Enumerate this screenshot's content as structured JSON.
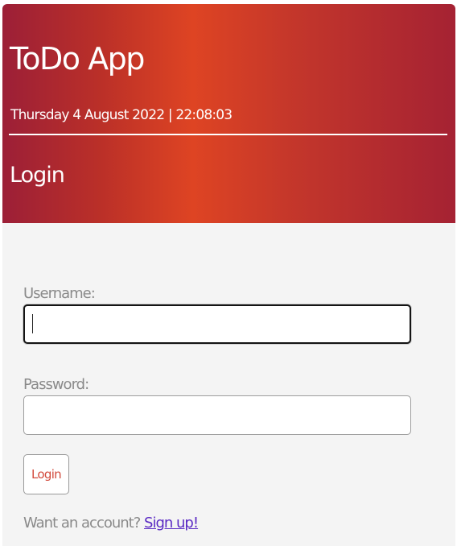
{
  "header": {
    "app_title": "ToDo App",
    "datetime": "Thursday 4 August 2022 | 22:08:03",
    "section_title": "Login"
  },
  "form": {
    "username_label": "Username:",
    "username_value": "",
    "password_label": "Password:",
    "password_value": "",
    "login_button_label": "Login",
    "signup_prompt": "Want an account?",
    "signup_link_label": "Sign up!"
  },
  "colors": {
    "header_gradient": [
      "#9c1f37",
      "#de4423",
      "#a52233"
    ],
    "button_text": "#d24a3c",
    "link": "#5b2bc4",
    "label": "#8a8a8a"
  }
}
